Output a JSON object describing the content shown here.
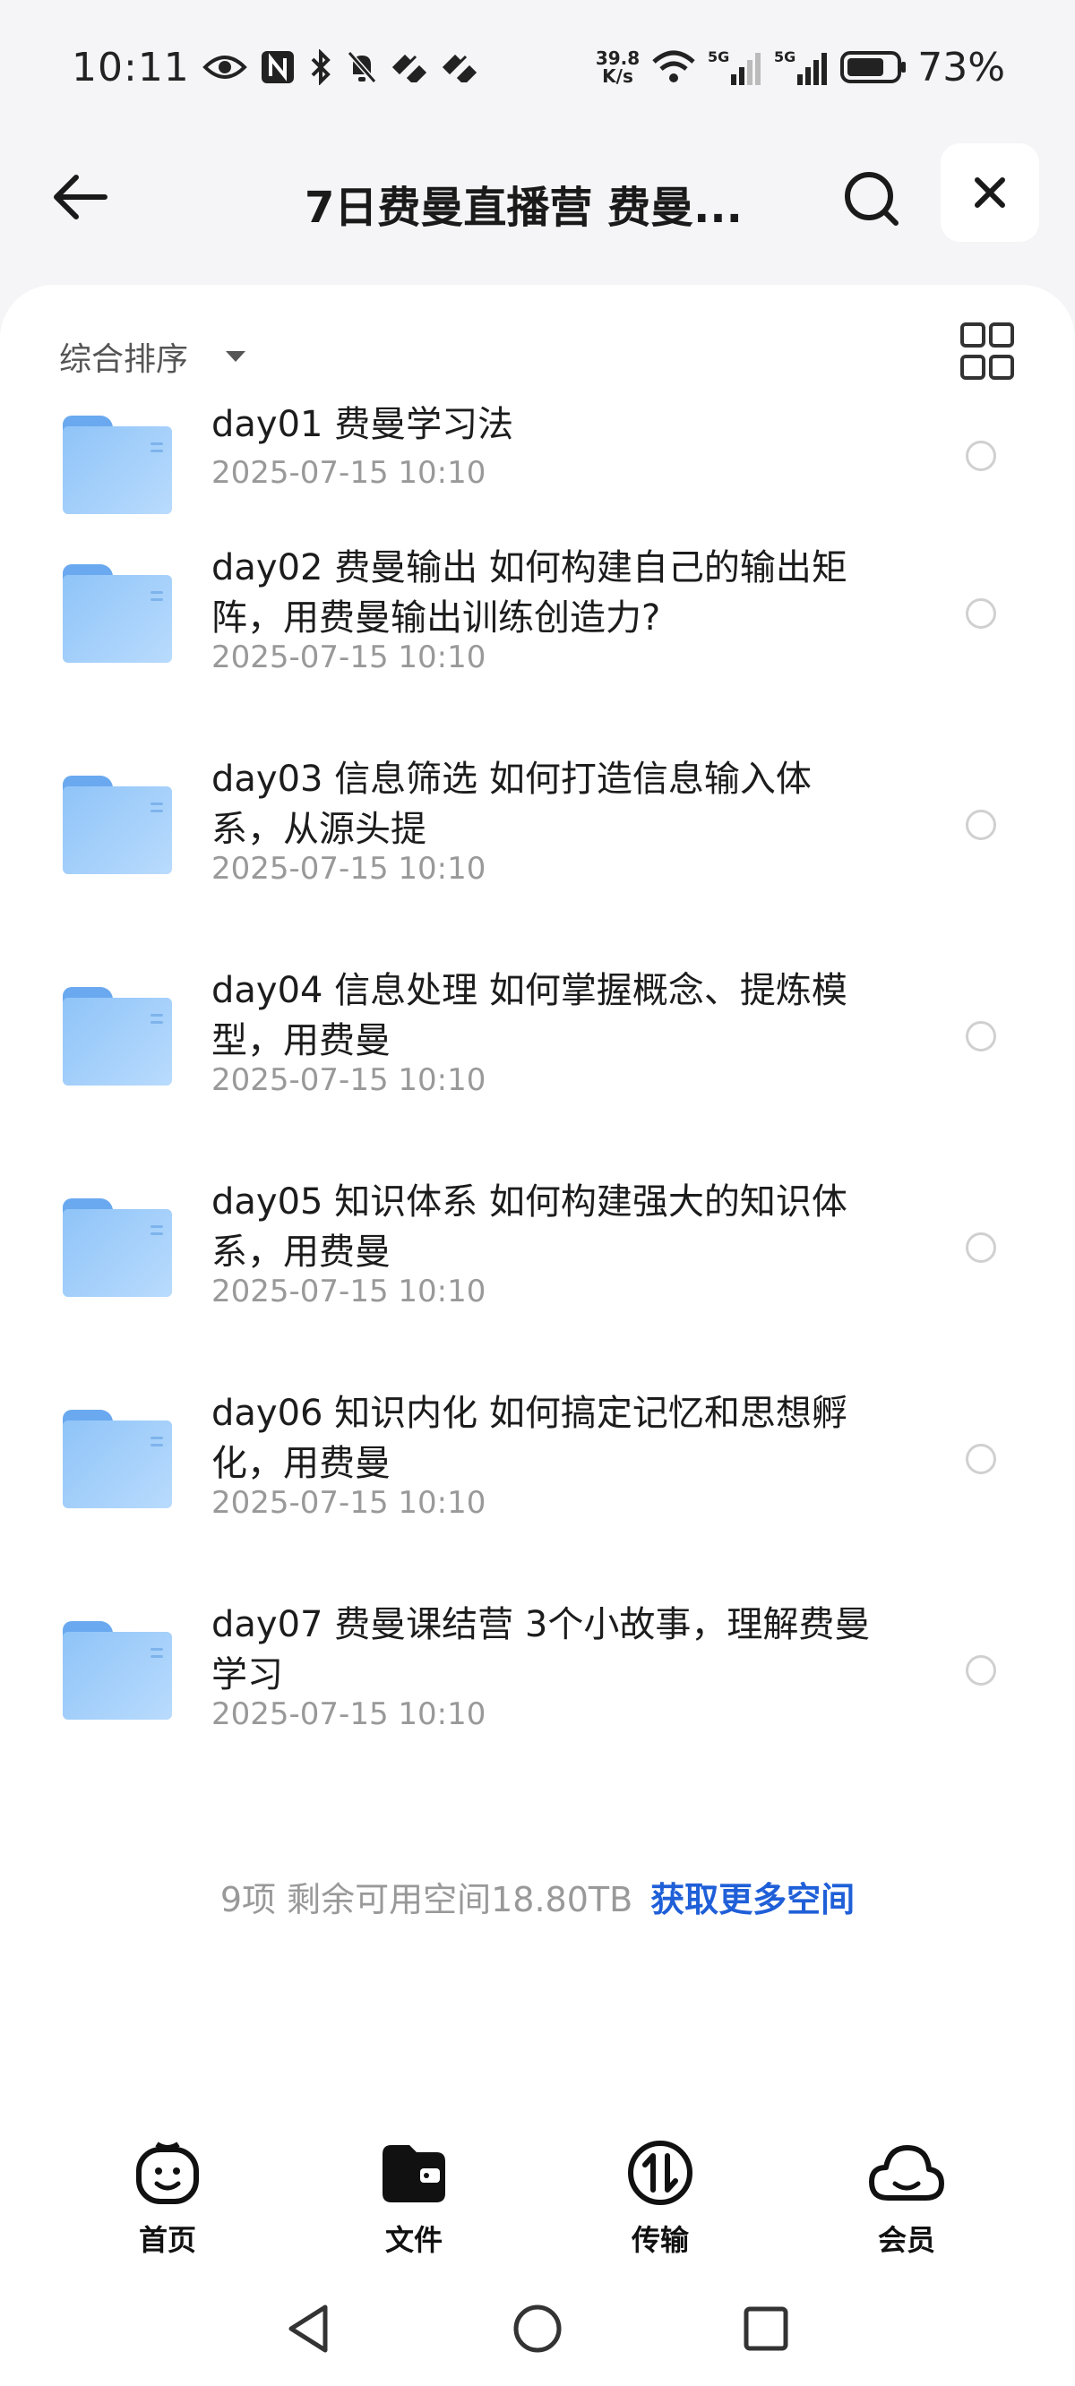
{
  "status_bar": {
    "time": "10:11",
    "net_speed_value": "39.8",
    "net_speed_unit": "K/s",
    "sim1": "5G",
    "sim2": "5G",
    "battery": "73%"
  },
  "header": {
    "title": "7日费曼直播营 费曼..."
  },
  "toolbar": {
    "sort_label": "综合排序"
  },
  "files": [
    {
      "name": "day01 费曼学习法",
      "date": "2025-07-15 10:10"
    },
    {
      "name": "day02 费曼输出  如何构建自己的输出矩阵，用费曼输出训练创造力?",
      "date": "2025-07-15 10:10"
    },
    {
      "name": "day03 信息筛选  如何打造信息输入体系，从源头提",
      "date": "2025-07-15 10:10"
    },
    {
      "name": "day04 信息处理  如何掌握概念、提炼模型，用费曼",
      "date": "2025-07-15 10:10"
    },
    {
      "name": "day05 知识体系  如何构建强大的知识体系，用费曼",
      "date": "2025-07-15 10:10"
    },
    {
      "name": "day06 知识内化  如何搞定记忆和思想孵化，用费曼",
      "date": "2025-07-15 10:10"
    },
    {
      "name": "day07 费曼课结营 3个小故事，理解费曼学习",
      "date": "2025-07-15 10:10"
    }
  ],
  "footer": {
    "count_text": "9项 剩余可用空间18.80TB",
    "more_space_link": "获取更多空间"
  },
  "bottom_nav": [
    {
      "label": "首页",
      "icon": "smile-home-icon"
    },
    {
      "label": "文件",
      "icon": "folder-files-icon"
    },
    {
      "label": "传输",
      "icon": "transfer-icon"
    },
    {
      "label": "会员",
      "icon": "cloud-member-icon"
    }
  ],
  "colors": {
    "accent_link": "#1f5fd8",
    "folder": "#8fc4f8",
    "background": "#f5f5f7"
  }
}
